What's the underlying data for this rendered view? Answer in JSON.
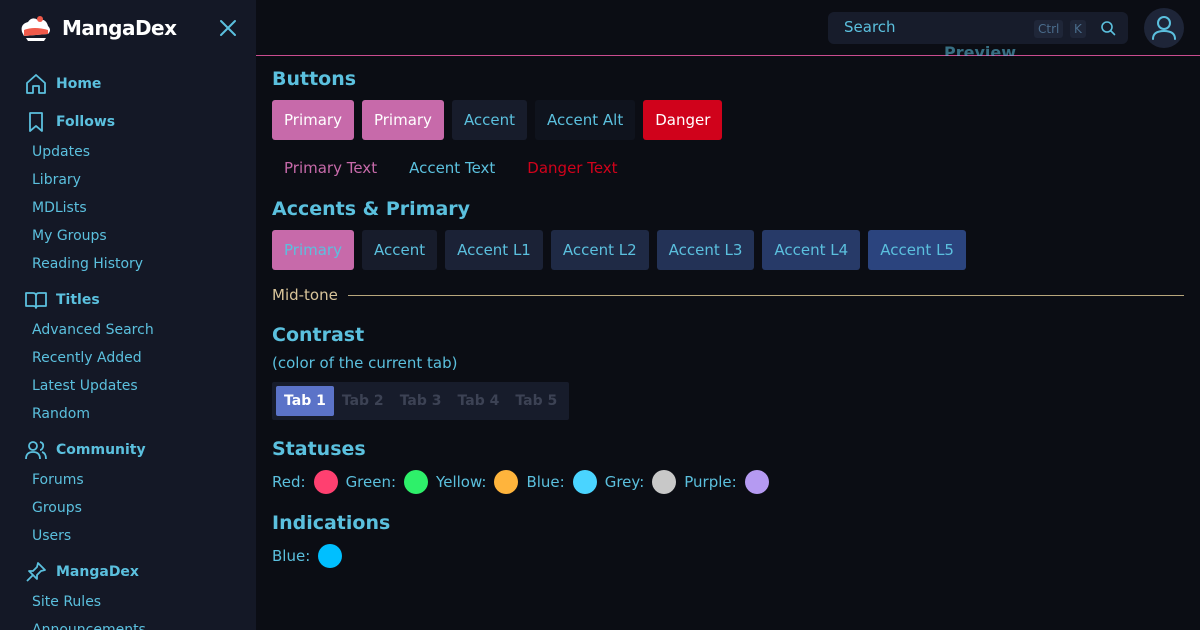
{
  "app": {
    "name": "MangaDex"
  },
  "sidebar": {
    "sections": [
      {
        "label": "Home",
        "icon": "home-icon",
        "items": []
      },
      {
        "label": "Follows",
        "icon": "bookmark-icon",
        "items": [
          "Updates",
          "Library",
          "MDLists",
          "My Groups",
          "Reading History"
        ]
      },
      {
        "label": "Titles",
        "icon": "book-open-icon",
        "items": [
          "Advanced Search",
          "Recently Added",
          "Latest Updates",
          "Random"
        ]
      },
      {
        "label": "Community",
        "icon": "users-icon",
        "items": [
          "Forums",
          "Groups",
          "Users"
        ]
      },
      {
        "label": "MangaDex",
        "icon": "pin-icon",
        "items": [
          "Site Rules",
          "Announcements"
        ]
      }
    ]
  },
  "topbar": {
    "search_placeholder": "Search",
    "kbd_ctrl": "Ctrl",
    "kbd_k": "K",
    "preview_label": "Preview"
  },
  "main": {
    "buttons": {
      "heading": "Buttons",
      "solid": [
        {
          "label": "Primary",
          "bg": "#c76aaa",
          "fg": "#ffffff"
        },
        {
          "label": "Primary",
          "bg": "#c76aaa",
          "fg": "#ffffff"
        },
        {
          "label": "Accent",
          "bg": "#171c2b",
          "fg": "#5bc0de"
        },
        {
          "label": "Accent Alt",
          "bg": "#0f131d",
          "fg": "#5bc0de"
        },
        {
          "label": "Danger",
          "bg": "#d0021b",
          "fg": "#ffffff"
        }
      ],
      "text": [
        {
          "label": "Primary Text",
          "fg": "#c76aaa"
        },
        {
          "label": "Accent Text",
          "fg": "#5bc0de"
        },
        {
          "label": "Danger Text",
          "fg": "#d0021b"
        }
      ]
    },
    "accents": {
      "heading": "Accents & Primary",
      "items": [
        {
          "label": "Primary",
          "bg": "#c76aaa",
          "fg": "#5bc0de"
        },
        {
          "label": "Accent",
          "bg": "#171c2b",
          "fg": "#5bc0de"
        },
        {
          "label": "Accent L1",
          "bg": "#1b2236",
          "fg": "#5bc0de"
        },
        {
          "label": "Accent L2",
          "bg": "#1f2a45",
          "fg": "#5bc0de"
        },
        {
          "label": "Accent L3",
          "bg": "#233256",
          "fg": "#5bc0de"
        },
        {
          "label": "Accent L4",
          "bg": "#273a68",
          "fg": "#5bc0de"
        },
        {
          "label": "Accent L5",
          "bg": "#2b447e",
          "fg": "#5bc0de"
        }
      ]
    },
    "midtone_label": "Mid-tone",
    "contrast": {
      "heading": "Contrast",
      "subtitle": "(color of the current tab)",
      "tabs": [
        "Tab 1",
        "Tab 2",
        "Tab 3",
        "Tab 4",
        "Tab 5"
      ],
      "active_tab": 0
    },
    "statuses": {
      "heading": "Statuses",
      "items": [
        {
          "label": "Red:",
          "color": "#ff4070"
        },
        {
          "label": "Green:",
          "color": "#2ef06a"
        },
        {
          "label": "Yellow:",
          "color": "#ffb43c"
        },
        {
          "label": "Blue:",
          "color": "#4ad4ff"
        },
        {
          "label": "Grey:",
          "color": "#c8c8c8"
        },
        {
          "label": "Purple:",
          "color": "#b59af2"
        }
      ]
    },
    "indications": {
      "heading": "Indications",
      "items": [
        {
          "label": "Blue:",
          "color": "#00bfff"
        }
      ]
    }
  }
}
